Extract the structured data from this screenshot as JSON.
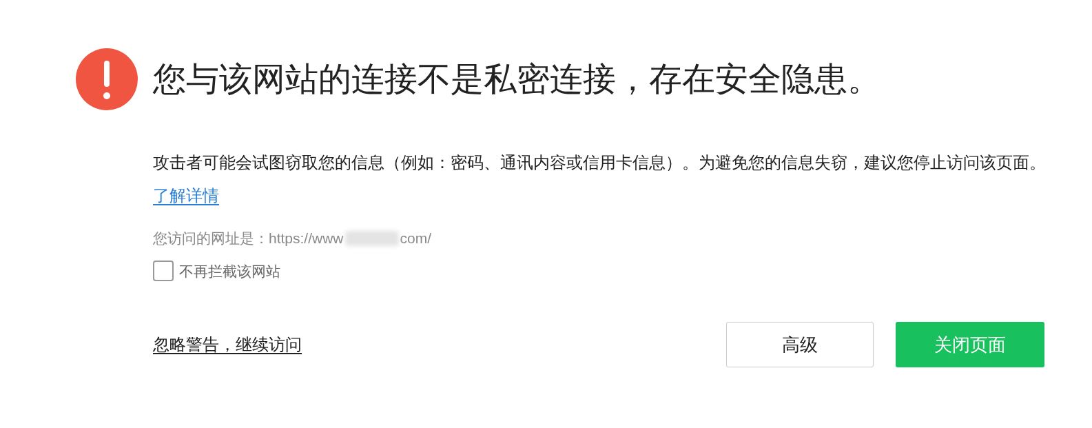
{
  "title": "您与该网站的连接不是私密连接，存在安全隐患。",
  "description": "攻击者可能会试图窃取您的信息（例如：密码、通讯内容或信用卡信息）。为避免您的信息失窃，建议您停止访问该页面。",
  "details_link": "了解详情",
  "url_label": "您访问的网址是：https://www",
  "url_end": "com/",
  "dont_block": {
    "label": "不再拦截该网站",
    "checked": false
  },
  "ignore_link": "忽略警告，继续访问",
  "buttons": [
    {
      "label": "高级",
      "kind": "secondary"
    },
    {
      "label": "关闭页面",
      "kind": "primary"
    }
  ]
}
